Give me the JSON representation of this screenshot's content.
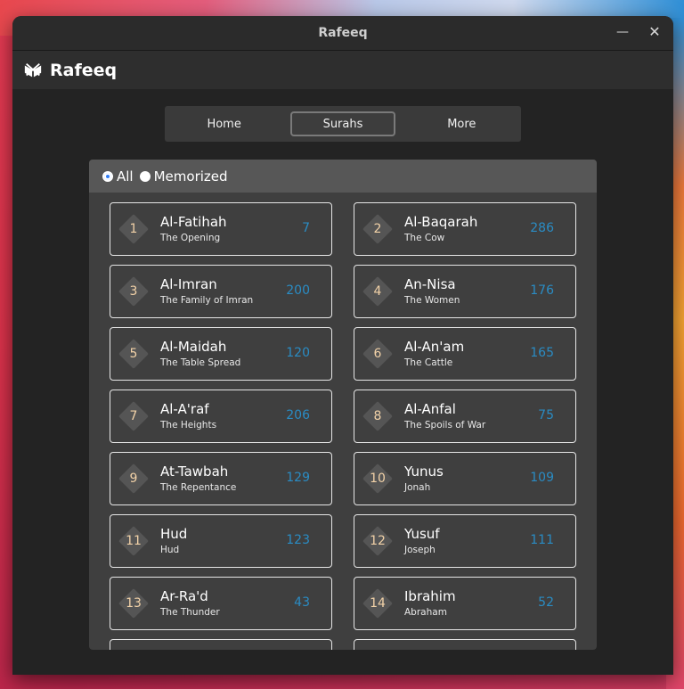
{
  "window": {
    "title": "Rafeeq",
    "minimize_icon": "minimize-icon",
    "close_icon": "close-icon"
  },
  "app": {
    "brand": "Rafeeq",
    "logo_icon": "quran-book-icon"
  },
  "nav": {
    "tabs": [
      {
        "label": "Home"
      },
      {
        "label": "Surahs",
        "active": true
      },
      {
        "label": "More"
      }
    ]
  },
  "filter": {
    "all_label": "All",
    "memorized_label": "Memorized",
    "selected": "All"
  },
  "colors": {
    "accent_verses": "#2a8cc4",
    "badge_number": "#f2d2a8",
    "radio_selected": "#2f7cf6"
  },
  "surahs": [
    {
      "number": "1",
      "name": "Al-Fatihah",
      "meaning": "The Opening",
      "verses": "7"
    },
    {
      "number": "2",
      "name": "Al-Baqarah",
      "meaning": "The Cow",
      "verses": "286"
    },
    {
      "number": "3",
      "name": "Al-Imran",
      "meaning": "The Family of Imran",
      "verses": "200"
    },
    {
      "number": "4",
      "name": "An-Nisa",
      "meaning": "The Women",
      "verses": "176"
    },
    {
      "number": "5",
      "name": "Al-Maidah",
      "meaning": "The Table Spread",
      "verses": "120"
    },
    {
      "number": "6",
      "name": "Al-An'am",
      "meaning": "The Cattle",
      "verses": "165"
    },
    {
      "number": "7",
      "name": "Al-A'raf",
      "meaning": "The Heights",
      "verses": "206"
    },
    {
      "number": "8",
      "name": "Al-Anfal",
      "meaning": "The Spoils of War",
      "verses": "75"
    },
    {
      "number": "9",
      "name": "At-Tawbah",
      "meaning": "The Repentance",
      "verses": "129"
    },
    {
      "number": "10",
      "name": "Yunus",
      "meaning": "Jonah",
      "verses": "109"
    },
    {
      "number": "11",
      "name": "Hud",
      "meaning": "Hud",
      "verses": "123"
    },
    {
      "number": "12",
      "name": "Yusuf",
      "meaning": "Joseph",
      "verses": "111"
    },
    {
      "number": "13",
      "name": "Ar-Ra'd",
      "meaning": "The Thunder",
      "verses": "43"
    },
    {
      "number": "14",
      "name": "Ibrahim",
      "meaning": "Abraham",
      "verses": "52"
    }
  ]
}
